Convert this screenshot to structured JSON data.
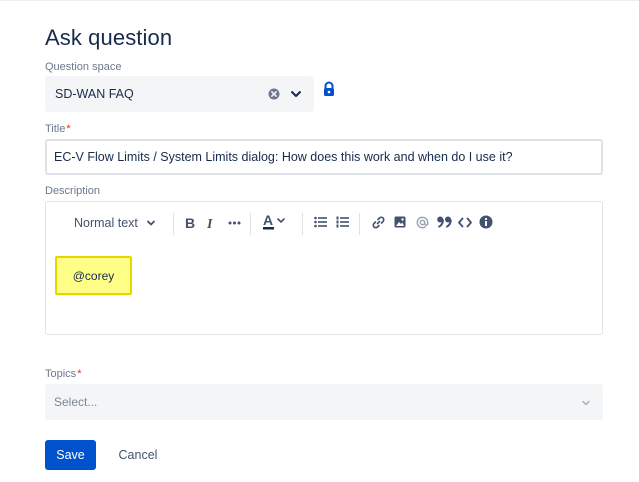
{
  "page": {
    "heading": "Ask question"
  },
  "space": {
    "label": "Question space",
    "value": "SD-WAN FAQ",
    "clear_icon": "clear-circle-icon",
    "chevron_icon": "chevron-down-icon",
    "lock_icon": "lock-icon"
  },
  "title_field": {
    "label": "Title",
    "required_mark": "*",
    "value": "EC-V Flow Limits / System Limits dialog: How does this work and when do I use it?"
  },
  "description": {
    "label": "Description",
    "toolbar": {
      "text_style": "Normal text",
      "items": [
        "bold-icon",
        "italic-icon",
        "more-formatting-icon",
        "text-color-icon",
        "bullet-list-icon",
        "numbered-list-icon",
        "link-icon",
        "image-icon",
        "mention-icon",
        "quote-icon",
        "code-icon",
        "info-panel-icon"
      ]
    },
    "body_text": "@corey"
  },
  "topics": {
    "label": "Topics",
    "required_mark": "*",
    "placeholder": "Select..."
  },
  "actions": {
    "save": "Save",
    "cancel": "Cancel"
  },
  "colors": {
    "primary": "#0052CC",
    "text": "#172B4D",
    "label": "#6B778C",
    "required": "#DE350B",
    "highlight": "#FFFF88",
    "field_bg": "#F4F5F7"
  }
}
